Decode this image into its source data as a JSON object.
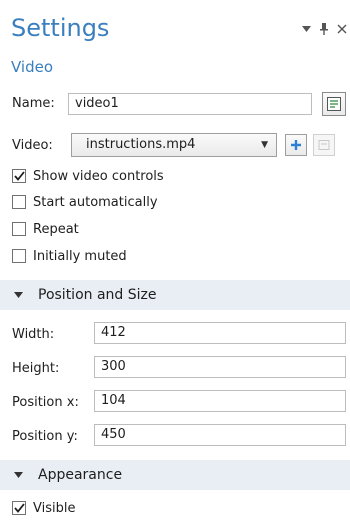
{
  "panel": {
    "title": "Settings",
    "subtitle": "Video",
    "window_buttons": [
      {
        "name": "dropdown-icon",
        "glyph": "▾"
      },
      {
        "name": "pin-icon",
        "glyph": "⊥"
      },
      {
        "name": "close-icon",
        "glyph": "×"
      }
    ]
  },
  "form": {
    "name_label": "Name:",
    "name_value": "video1",
    "video_label": "Video:",
    "video_value": "instructions.mp4",
    "options": [
      {
        "label": "Show video controls",
        "checked": true
      },
      {
        "label": "Start automatically",
        "checked": false
      },
      {
        "label": "Repeat",
        "checked": false
      },
      {
        "label": "Initially muted",
        "checked": false
      }
    ]
  },
  "position_section": {
    "title": "Position and Size",
    "fields": [
      {
        "label": "Width:",
        "value": "412"
      },
      {
        "label": "Height:",
        "value": "300"
      },
      {
        "label": "Position x:",
        "value": "104"
      },
      {
        "label": "Position y:",
        "value": "450"
      }
    ]
  },
  "appearance_section": {
    "title": "Appearance",
    "visible_label": "Visible",
    "visible_checked": true
  },
  "colors": {
    "accent": "#3a7fbf",
    "section_bg": "#e9eef5",
    "add_icon": "#2f7fd6"
  }
}
